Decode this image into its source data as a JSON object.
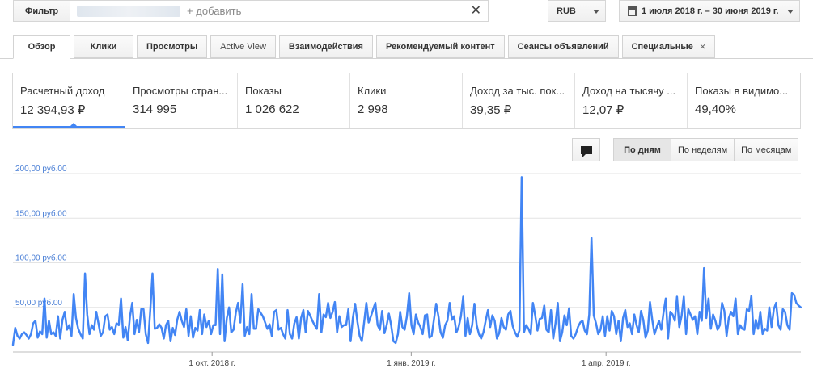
{
  "filter": {
    "button_label": "Фильтр",
    "add_placeholder": "+ добавить",
    "clear_icon": "close-icon"
  },
  "currency": {
    "label": "RUB"
  },
  "date_range": {
    "label": "1 июля 2018 г. – 30 июня 2019 г."
  },
  "tabs": [
    {
      "label": "Обзор"
    },
    {
      "label": "Клики"
    },
    {
      "label": "Просмотры"
    },
    {
      "label": "Active View"
    },
    {
      "label": "Взаимодействия"
    },
    {
      "label": "Рекомендуемый контент"
    },
    {
      "label": "Сеансы объявлений"
    },
    {
      "label": "Специальные",
      "close": "×"
    }
  ],
  "metrics": [
    {
      "label": "Расчетный доход",
      "value": "12 394,93 ₽"
    },
    {
      "label": "Просмотры стран...",
      "value": "314 995"
    },
    {
      "label": "Показы",
      "value": "1 026 622"
    },
    {
      "label": "Клики",
      "value": "2 998"
    },
    {
      "label": "Доход за тыс. пок...",
      "value": "39,35 ₽"
    },
    {
      "label": "Доход на тысячу ...",
      "value": "12,07 ₽"
    },
    {
      "label": "Показы в видимо...",
      "value": "49,40%"
    }
  ],
  "period_buttons": [
    {
      "label": "По дням"
    },
    {
      "label": "По неделям"
    },
    {
      "label": "По месяцам"
    }
  ],
  "colors": {
    "accent": "#4285f4",
    "axis_label": "#4a7fd6"
  },
  "chart_data": {
    "type": "line",
    "title": "",
    "xlabel": "",
    "ylabel": "",
    "x": [
      "2018-07-01",
      "2019-06-30"
    ],
    "xticks": [
      {
        "date": "2018-10-01",
        "label": "1 окт. 2018 г."
      },
      {
        "date": "2019-01-01",
        "label": "1 янв. 2019 г."
      },
      {
        "date": "2019-04-01",
        "label": "1 апр. 2019 г."
      }
    ],
    "ylim": [
      0,
      200
    ],
    "yticks": [
      {
        "value": 50,
        "label": "50,00 руб.00"
      },
      {
        "value": 100,
        "label": "100,00 руб.00"
      },
      {
        "value": 150,
        "label": "150,00 руб.00"
      },
      {
        "value": 200,
        "label": "200,00 руб.00"
      }
    ],
    "grid": true,
    "series": [
      {
        "name": "Расчетный доход",
        "color": "#4285f4",
        "values": [
          8,
          27,
          18,
          15,
          20,
          22,
          19,
          15,
          20,
          32,
          35,
          16,
          23,
          20,
          60,
          16,
          35,
          20,
          22,
          18,
          40,
          15,
          36,
          45,
          25,
          30,
          18,
          65,
          38,
          26,
          20,
          15,
          88,
          42,
          20,
          30,
          25,
          45,
          32,
          18,
          22,
          40,
          42,
          25,
          28,
          20,
          32,
          30,
          60,
          16,
          28,
          13,
          40,
          55,
          20,
          36,
          22,
          48,
          48,
          20,
          10,
          47,
          88,
          26,
          27,
          31,
          27,
          15,
          30,
          35,
          12,
          27,
          19,
          36,
          45,
          35,
          28,
          48,
          18,
          40,
          16,
          27,
          24,
          47,
          20,
          42,
          28,
          35,
          20,
          30,
          30,
          93,
          20,
          87,
          12,
          38,
          50,
          22,
          25,
          44,
          55,
          33,
          76,
          18,
          28,
          20,
          65,
          26,
          26,
          48,
          44,
          40,
          33,
          26,
          31,
          18,
          45,
          47,
          25,
          27,
          20,
          15,
          47,
          20,
          15,
          32,
          39,
          15,
          38,
          47,
          22,
          46,
          41,
          35,
          30,
          26,
          65,
          22,
          42,
          39,
          55,
          38,
          45,
          56,
          22,
          40,
          28,
          30,
          30,
          48,
          12,
          38,
          54,
          34,
          18,
          12,
          33,
          55,
          33,
          40,
          48,
          55,
          30,
          25,
          46,
          21,
          30,
          43,
          30,
          12,
          10,
          20,
          45,
          28,
          25,
          40,
          66,
          30,
          20,
          42,
          33,
          28,
          20,
          41,
          42,
          16,
          18,
          36,
          54,
          40,
          22,
          16,
          30,
          35,
          55,
          36,
          40,
          22,
          28,
          40,
          62,
          18,
          38,
          20,
          30,
          54,
          30,
          20,
          15,
          22,
          35,
          47,
          28,
          41,
          35,
          15,
          21,
          38,
          28,
          25,
          42,
          46,
          29,
          22,
          17,
          24,
          196,
          22,
          30,
          26,
          20,
          55,
          41,
          24,
          37,
          38,
          52,
          25,
          22,
          47,
          15,
          32,
          55,
          12,
          22,
          41,
          30,
          49,
          18,
          15,
          20,
          28,
          33,
          35,
          24,
          20,
          42,
          128,
          41,
          32,
          20,
          25,
          40,
          18,
          40,
          24,
          46,
          40,
          20,
          35,
          12,
          38,
          47,
          28,
          32,
          20,
          42,
          30,
          22,
          46,
          36,
          16,
          24,
          56,
          36,
          20,
          28,
          35,
          25,
          44,
          60,
          15,
          45,
          42,
          35,
          62,
          28,
          40,
          62,
          20,
          48,
          42,
          36,
          40,
          20,
          45,
          35,
          94,
          38,
          60,
          26,
          42,
          35,
          25,
          30,
          55,
          46,
          18,
          38,
          45,
          40,
          60,
          20,
          30,
          26,
          25,
          48,
          46,
          63,
          20,
          36,
          26,
          45,
          20,
          26,
          24,
          50,
          28,
          48,
          55,
          30,
          25,
          48,
          45,
          30,
          25,
          66,
          64,
          55,
          52,
          50
        ]
      }
    ]
  }
}
